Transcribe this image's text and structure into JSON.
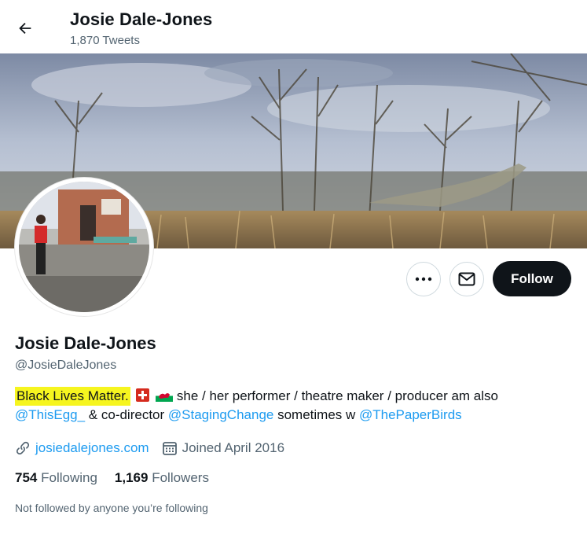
{
  "header": {
    "name": "Josie Dale-Jones",
    "tweet_count": "1,870 Tweets"
  },
  "profile": {
    "display_name": "Josie Dale-Jones",
    "handle": "@JosieDaleJones",
    "bio": {
      "highlight": "Black Lives Matter.",
      "text_1": " she / her performer / theatre maker / producer am also",
      "mention_1": "@ThisEgg_",
      "text_2": " & co-director ",
      "mention_2": "@StagingChange",
      "text_3": " sometimes w ",
      "mention_3": "@ThePaperBirds"
    },
    "website": "josiedalejones.com",
    "joined": "Joined April 2016",
    "following_count": "754",
    "following_label": "Following",
    "followers_count": "1,169",
    "followers_label": "Followers",
    "not_followed": "Not followed by anyone you’re following"
  },
  "actions": {
    "follow_label": "Follow",
    "more_glyph": "•••"
  },
  "icons": {
    "back": "arrow-left-icon",
    "more": "more-icon",
    "message": "envelope-icon",
    "link": "link-icon",
    "calendar": "calendar-icon",
    "flag_1": "swiss-flag-icon",
    "flag_2": "welsh-flag-icon"
  },
  "colors": {
    "accent": "#1d9bf0",
    "text": "#0f1419",
    "muted": "#536471",
    "highlight": "#f6f51f",
    "follow_bg": "#0f1419"
  }
}
